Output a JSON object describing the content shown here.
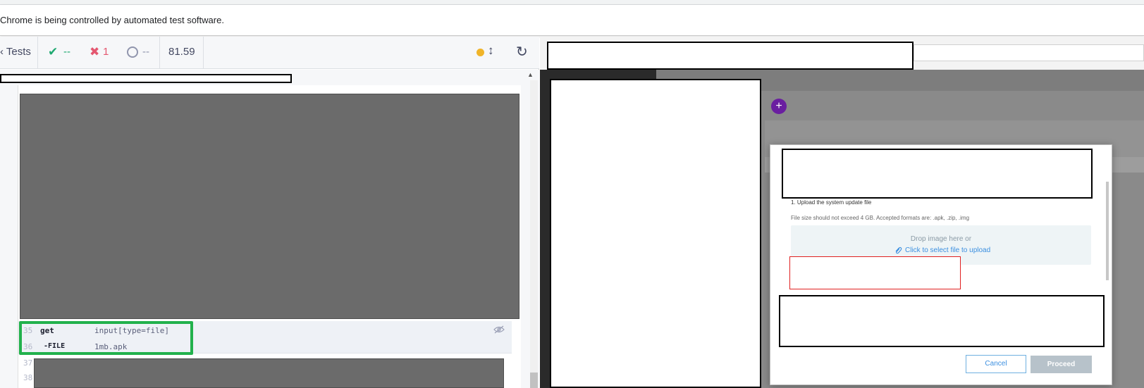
{
  "chrome": {
    "infobar_text": "Chrome is being controlled by automated test software."
  },
  "reporter": {
    "tests_label": "Tests",
    "passed_count": "--",
    "failed_count": "1",
    "pending_count": "--",
    "duration": "81.59",
    "commands": [
      {
        "line": "35",
        "name": "get",
        "arg": "input[type=file]"
      },
      {
        "line": "36",
        "name": "-FILE",
        "arg": "1mb.apk"
      },
      {
        "line": "37"
      },
      {
        "line": "38"
      }
    ]
  },
  "modal": {
    "step_label": "1. Upload the system update file",
    "size_note": "File size should not exceed 4 GB. Accepted formats are: .apk, .zip, .img",
    "drop_text": "Drop image here or",
    "select_link": "Click to select file to upload",
    "cancel_label": "Cancel",
    "proceed_label": "Proceed"
  },
  "colors": {
    "passed": "#1fa971",
    "failed": "#e45770",
    "highlight": "#22b14c",
    "accent": "#3b8fe0",
    "add_button": "#6a1ea0"
  },
  "icons": [
    "chevron-left-icon",
    "check-icon",
    "x-icon",
    "pending-circle-icon",
    "status-dot-icon",
    "resize-arrows-icon",
    "reload-icon",
    "eye-off-icon",
    "plus-icon",
    "paperclip-icon"
  ]
}
